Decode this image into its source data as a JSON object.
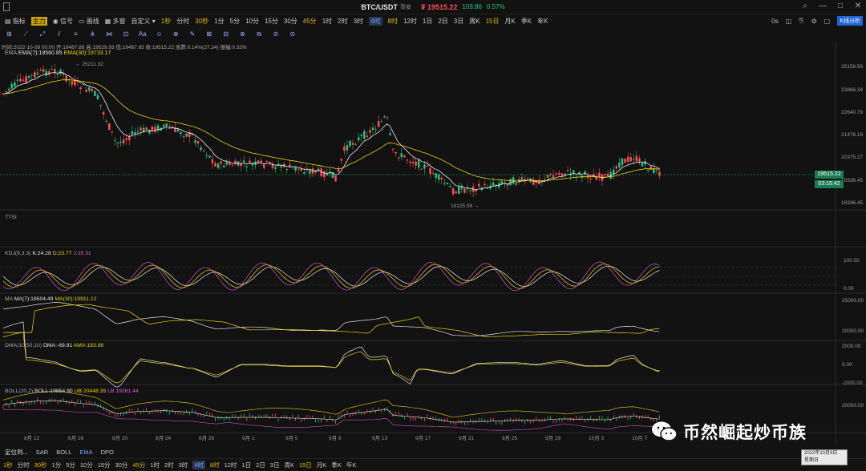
{
  "header": {
    "pair": "BTC/USDT",
    "exchange": "币安",
    "price": "₮ 19515.22",
    "change": "109.86",
    "change_pct": "0.57%"
  },
  "toolbar": {
    "items": [
      "指标",
      "主力",
      "信号",
      "画线",
      "多窗",
      "自定义"
    ],
    "timeframes": [
      "1秒",
      "分时",
      "30秒",
      "1分",
      "5分",
      "10分",
      "15分",
      "30分",
      "45分",
      "1时",
      "2时",
      "3时",
      "4时",
      "8时",
      "12时",
      "1日",
      "2日",
      "3日",
      "周K",
      "15日",
      "月K",
      "季K",
      "年K"
    ],
    "right_items": [
      "0s",
      "K线分析"
    ]
  },
  "info_line": "时间:2022-10-09 00:00  开:19487.88  高:19529.93  低:19467.65  收:19515.22  涨跌:0.14%(27.34)  振幅:0.32%",
  "ema_legend": {
    "name": "EMA",
    "ema7": "EMA(7):19560.85",
    "ema30": "EMA(30):19733.17"
  },
  "price_labels": {
    "high": "25211.32",
    "low": "18125.98"
  },
  "y_axis_main": [
    "25158.56",
    "23866.34",
    "22640.79",
    "21478.16",
    "20375.27",
    "19336.45",
    "18336.45"
  ],
  "current_price_box": "19515.22",
  "countdown_box": "03:15:42",
  "panels": {
    "ttsi": {
      "name": "TTSI"
    },
    "kdj": {
      "name": "KDJ(9,3,3)",
      "k": "K:24.28",
      "d": "D:23.77",
      "j": "J:25.31",
      "axis": [
        "100.00",
        "0.00"
      ]
    },
    "ma": {
      "name": "MA",
      "ma7": "MA(7):19504.49",
      "ma30": "MA(30):19911.12",
      "axis": [
        "25000.00",
        "20000.00"
      ]
    },
    "dma": {
      "name": "DMA(10,50,10)",
      "dma": "DMA:-69.81",
      "ama": "AMA:183.88",
      "axis": [
        "2000.00",
        "0.00",
        "-2000.00"
      ]
    },
    "boll": {
      "name": "BOLL(20,2)",
      "boll": "BOLL:19854.90",
      "ub": "UB:20448.35",
      "lb": "LB:19261.44",
      "axis": [
        "20000.00"
      ]
    }
  },
  "x_axis": [
    "8月 12",
    "8月 16",
    "8月 20",
    "8月 24",
    "8月 28",
    "9月 1",
    "9月 5",
    "9月 9",
    "9月 13",
    "9月 17",
    "9月 21",
    "9月 25",
    "9月 29",
    "10月 3",
    "10月 7"
  ],
  "indicator_tabs": [
    "SAR",
    "BOLL",
    "EMA",
    "DPO"
  ],
  "bottom_timeframes": [
    "1秒",
    "分时",
    "30秒",
    "1分",
    "5分",
    "10分",
    "15分",
    "30分",
    "45分",
    "1时",
    "2时",
    "3时",
    "4时",
    "8时",
    "12时",
    "1日",
    "2日",
    "3日",
    "周K",
    "15日",
    "月K",
    "季K",
    "年K"
  ],
  "bottom_left": "定位到...",
  "datebox": {
    "line1": "2022年10月9日",
    "line2": "星期日"
  },
  "watermark": "币然崛起炒币族",
  "colors": {
    "up": "#26c281",
    "down": "#ff4d4f",
    "ema7": "#e6e6e6",
    "ema30": "#f0d000",
    "accent": "#1e64d6"
  }
}
